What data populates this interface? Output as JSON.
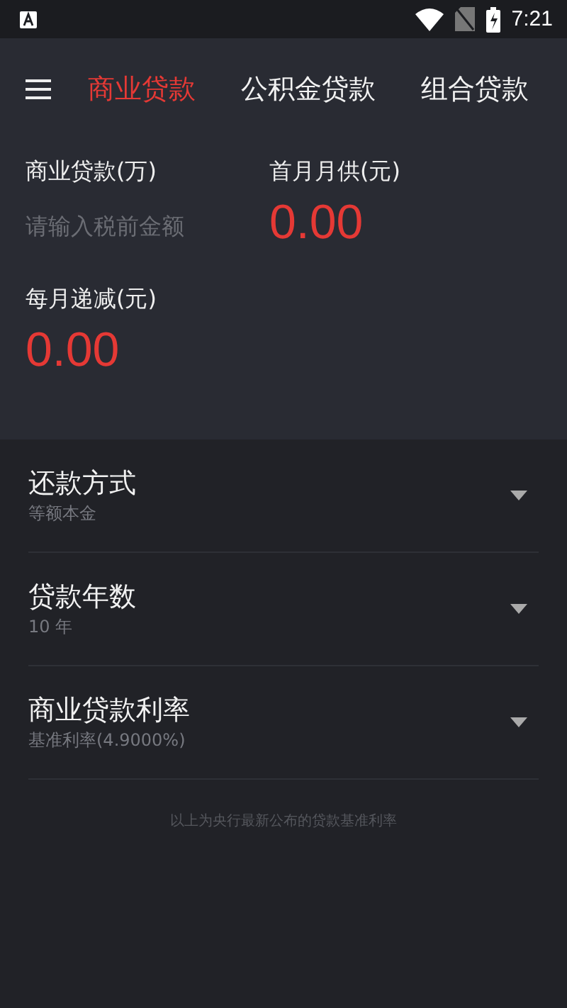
{
  "status_bar": {
    "time": "7:21"
  },
  "tabs": [
    {
      "label": "商业贷款",
      "selected": true
    },
    {
      "label": "公积金贷款",
      "selected": false
    },
    {
      "label": "组合贷款",
      "selected": false
    }
  ],
  "loan_field": {
    "label": "商业贷款(万)",
    "placeholder": "请输入税前金额"
  },
  "first_payment": {
    "label": "首月月供(元)",
    "value": "0.00"
  },
  "monthly_decrease": {
    "label": "每月递减(元)",
    "value": "0.00"
  },
  "options": [
    {
      "title": "还款方式",
      "value": "等额本金"
    },
    {
      "title": "贷款年数",
      "value": "10 年"
    },
    {
      "title": "商业贷款利率",
      "value": "基准利率(4.9000%)"
    }
  ],
  "footnote": "以上为央行最新公布的贷款基准利率"
}
